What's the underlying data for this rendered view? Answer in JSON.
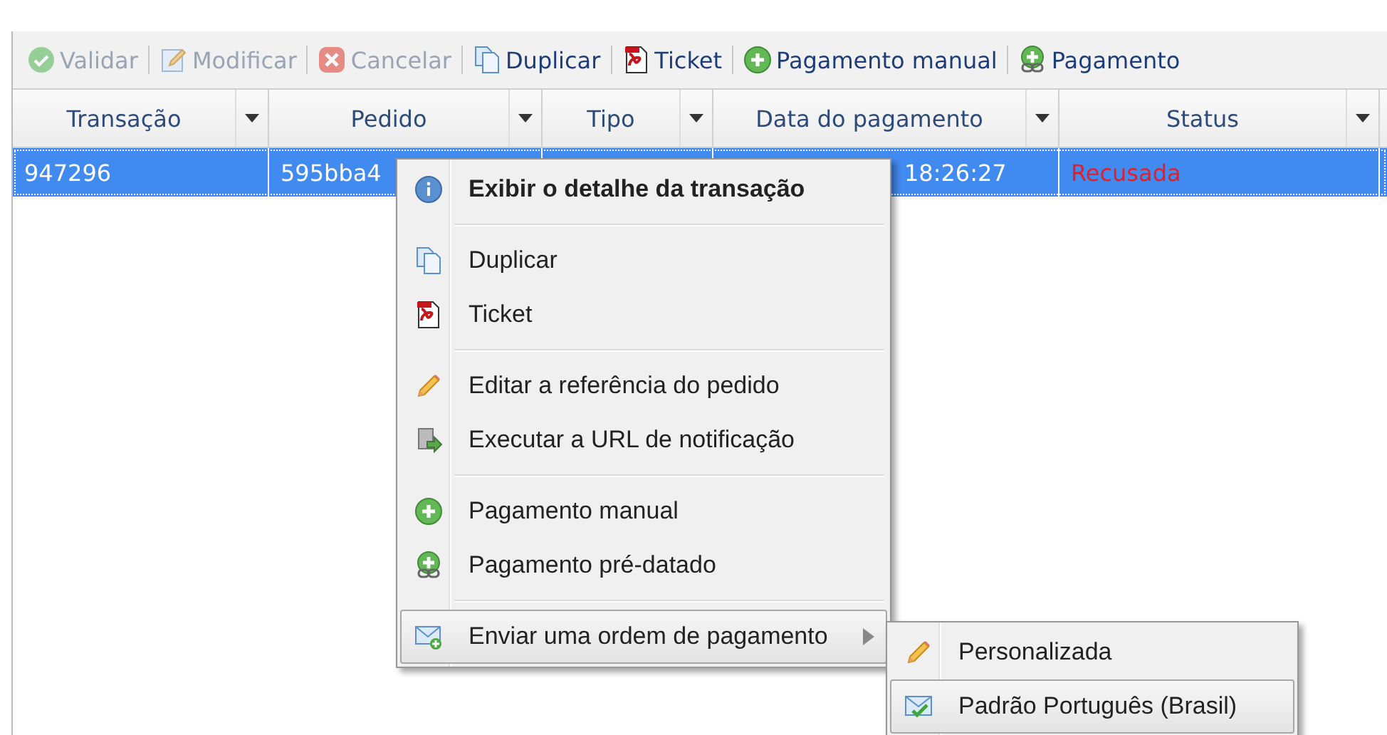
{
  "toolbar": [
    {
      "label": "Validar",
      "disabled": true
    },
    {
      "label": "Modificar",
      "disabled": true
    },
    {
      "label": "Cancelar",
      "disabled": true
    },
    {
      "label": "Duplicar",
      "disabled": false
    },
    {
      "label": "Ticket",
      "disabled": false
    },
    {
      "label": "Pagamento manual",
      "disabled": false
    },
    {
      "label": "Pagamento",
      "disabled": false
    }
  ],
  "table": {
    "columns": [
      "Transação",
      "Pedido",
      "Tipo",
      "Data do pagamento",
      "Status"
    ],
    "rows": [
      {
        "selected": true,
        "cells": [
          "947296",
          "595bba4",
          "",
          "18:26:27",
          "Recusada"
        ]
      }
    ]
  },
  "context_menu": {
    "items": [
      {
        "kind": "item",
        "label": "Exibir o detalhe da transação",
        "bold": true,
        "selected": false
      },
      {
        "kind": "separator"
      },
      {
        "kind": "item",
        "label": "Duplicar",
        "bold": false,
        "selected": false
      },
      {
        "kind": "item",
        "label": "Ticket",
        "bold": false,
        "selected": false
      },
      {
        "kind": "separator"
      },
      {
        "kind": "item",
        "label": "Editar a referência do pedido",
        "bold": false,
        "selected": false
      },
      {
        "kind": "item",
        "label": "Executar a URL de notificação",
        "bold": false,
        "selected": false
      },
      {
        "kind": "separator"
      },
      {
        "kind": "item",
        "label": "Pagamento manual",
        "bold": false,
        "selected": false
      },
      {
        "kind": "item",
        "label": "Pagamento pré-datado",
        "bold": false,
        "selected": false
      },
      {
        "kind": "separator"
      },
      {
        "kind": "submenu",
        "label": "Enviar uma ordem de pagamento",
        "bold": false,
        "selected": true
      }
    ]
  },
  "submenu": {
    "items": [
      {
        "label": "Personalizada",
        "selected": false
      },
      {
        "label": "Padrão Português (Brasil)",
        "selected": true
      }
    ]
  }
}
